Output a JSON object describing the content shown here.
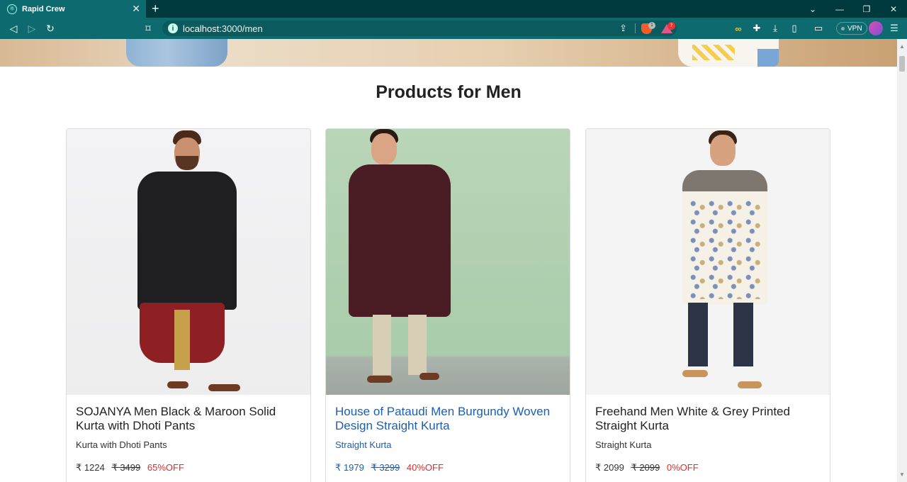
{
  "browser": {
    "tab_title": "Rapid Crew",
    "tab_close": "✕",
    "new_tab": "+",
    "url_host": "localhost",
    "url_path": ":3000/men",
    "vpn_label": "VPN",
    "shield_badge": "1",
    "rewards_badge": "7"
  },
  "page": {
    "title": "Products for Men"
  },
  "products": [
    {
      "name": "SOJANYA Men Black & Maroon Solid Kurta with Dhoti Pants",
      "category": "Kurta with Dhoti Pants",
      "price": "₹ 1224",
      "mrp": "₹ 3499",
      "discount": "65%OFF"
    },
    {
      "name": "House of Pataudi Men Burgundy Woven Design Straight Kurta",
      "category": "Straight Kurta",
      "price": "₹ 1979",
      "mrp": "₹ 3299",
      "discount": "40%OFF"
    },
    {
      "name": "Freehand Men White & Grey Printed Straight Kurta",
      "category": "Straight Kurta",
      "price": "₹ 2099",
      "mrp": "₹ 2099",
      "discount": "0%OFF"
    }
  ],
  "colors": {
    "chrome_dark": "#013a3e",
    "chrome": "#0d6b6f",
    "link_blue": "#1a5fb4",
    "discount_red": "#e32b2b"
  }
}
